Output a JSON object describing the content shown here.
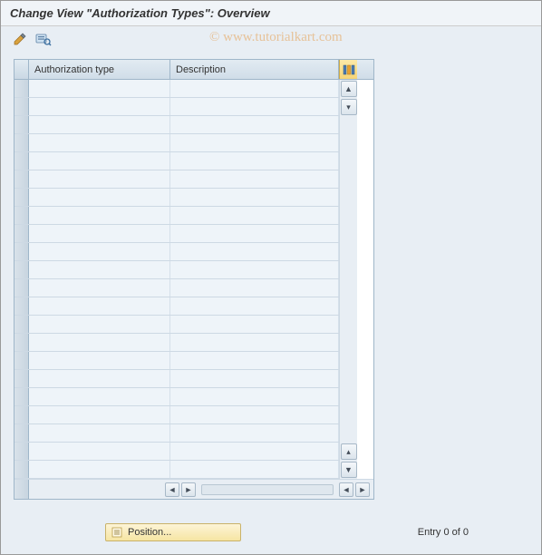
{
  "header": {
    "title": "Change View \"Authorization Types\": Overview"
  },
  "watermark": "© www.tutorialkart.com",
  "toolbar": {
    "edit_icon": "edit-icon",
    "selection_icon": "selection-icon"
  },
  "table": {
    "columns": {
      "auth_type": "Authorization type",
      "description": "Description"
    },
    "row_count": 22
  },
  "footer": {
    "position_label": "Position...",
    "entry_text": "Entry 0 of 0"
  }
}
